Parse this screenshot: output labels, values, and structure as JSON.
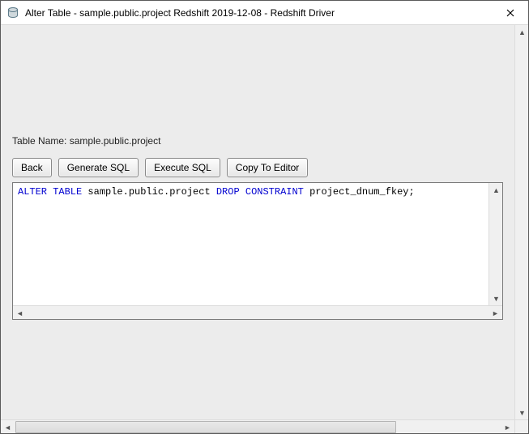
{
  "window": {
    "title": "Alter Table - sample.public.project Redshift 2019-12-08 - Redshift Driver"
  },
  "content": {
    "table_name_label": "Table Name: sample.public.project"
  },
  "buttons": {
    "back": "Back",
    "generate_sql": "Generate SQL",
    "execute_sql": "Execute SQL",
    "copy_to_editor": "Copy To Editor"
  },
  "sql": {
    "kw_alter_table": "ALTER TABLE",
    "target": " sample.public.project ",
    "kw_drop_constraint": "DROP CONSTRAINT",
    "rest": " project_dnum_fkey;"
  }
}
